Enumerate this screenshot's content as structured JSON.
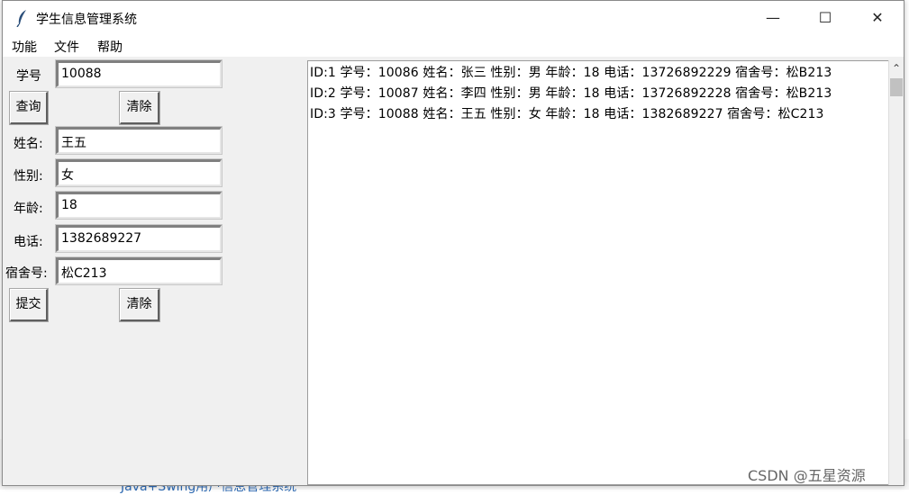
{
  "window": {
    "title": "学生信息管理系统"
  },
  "menu": [
    "功能",
    "文件",
    "帮助"
  ],
  "query": {
    "id_label": "学号",
    "id_value": "10088",
    "query_button": "查询",
    "clear_button": "清除"
  },
  "form": {
    "name_label": "姓名:",
    "name_value": "王五",
    "gender_label": "性别:",
    "gender_value": "女",
    "age_label": "年龄:",
    "age_value": "18",
    "phone_label": "电话:",
    "phone_value": "1382689227",
    "dorm_label": "宿舍号:",
    "dorm_value": "松C213",
    "submit_button": "提交",
    "clear_button": "清除"
  },
  "records": [
    "ID:1  学号：10086  姓名：张三  性别：男  年龄：18  电话：13726892229  宿舍号：松B213",
    "ID:2  学号：10087  姓名：李四  性别：男  年龄：18  电话：13726892228  宿舍号：松B213",
    "ID:3  学号：10088  姓名：王五  性别：女  年龄：18  电话：1382689227  宿舍号：松C213"
  ],
  "background": {
    "link_text": "Java+Swing用户信息管理系统"
  },
  "watermark": "CSDN @五星资源"
}
